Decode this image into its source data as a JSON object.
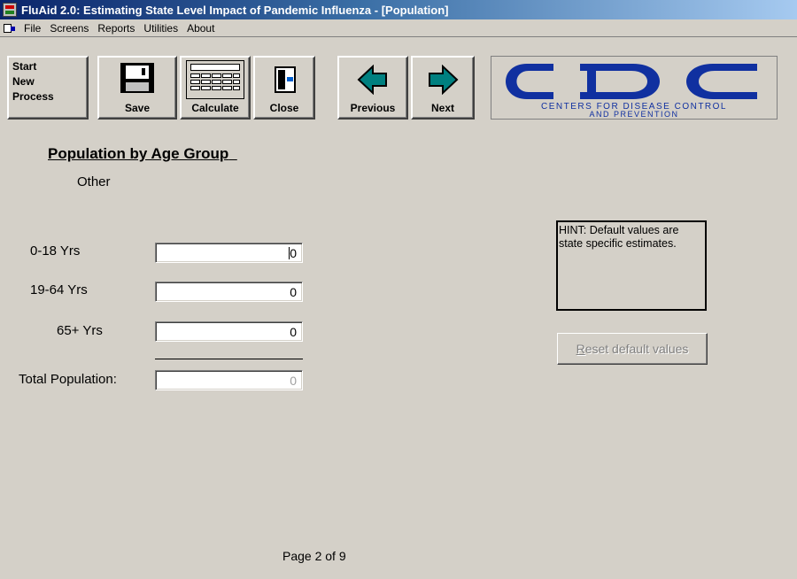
{
  "window": {
    "title": "FluAid 2.0: Estimating State Level Impact of Pandemic Influenza - [Population]"
  },
  "menu": {
    "items": [
      "File",
      "Screens",
      "Reports",
      "Utilities",
      "About"
    ]
  },
  "toolbar": {
    "start_label": "Start\nNew\nProcess",
    "save_label": "Save",
    "calculate_label": "Calculate",
    "close_label": "Close",
    "previous_label": "Previous",
    "next_label": "Next",
    "logo_text": "CDC",
    "logo_line1": "CENTERS FOR DISEASE CONTROL",
    "logo_line2": "AND PREVENTION"
  },
  "section": {
    "title": "Population by Age Group",
    "subtitle": "Other"
  },
  "fields": [
    {
      "label": "0-18 Yrs",
      "value": "0",
      "focused": true
    },
    {
      "label": "19-64 Yrs",
      "value": "0"
    },
    {
      "label": "65+ Yrs",
      "value": "0"
    }
  ],
  "total": {
    "label": "Total Population:",
    "value": "0"
  },
  "hint": {
    "text": "HINT: Default values are state specific estimates."
  },
  "reset_button": {
    "label": "Reset default values"
  },
  "page_indicator": "Page 2 of 9",
  "colors": {
    "window_bg": "#d4d0c8",
    "titlebar_start": "#0a246a",
    "titlebar_end": "#a6caf0",
    "arrow_fill": "#008080",
    "logo_blue": "#1030a0"
  },
  "icons": {
    "save": "floppy-disk-icon",
    "calculate": "calculator-icon",
    "close": "door-exit-icon",
    "previous": "left-arrow-icon",
    "next": "right-arrow-icon"
  }
}
